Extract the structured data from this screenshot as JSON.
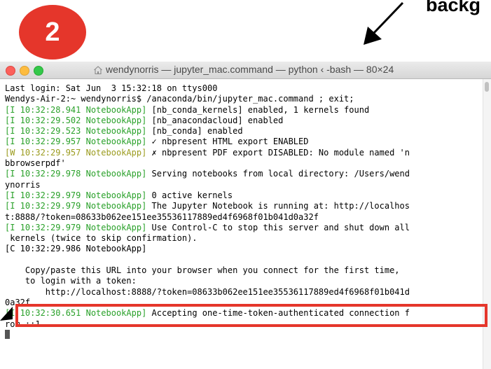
{
  "annotation": {
    "step_number": "2",
    "label_partial": "backg",
    "highlight_color": "#e5362b"
  },
  "window": {
    "title": "wendynorris — jupyter_mac.command — python ‹ -bash — 80×24",
    "title_icon": "home-icon",
    "traffic_lights": [
      "close",
      "minimize",
      "maximize"
    ]
  },
  "terminal": {
    "lines": [
      {
        "prefix": "",
        "body": "Last login: Sat Jun  3 15:32:18 on ttys000"
      },
      {
        "prefix": "",
        "body": "Wendys-Air-2:~ wendynorris$ /anaconda/bin/jupyter_mac.command ; exit;"
      },
      {
        "prefix": "[I 10:32:28.941 NotebookApp]",
        "body": " [nb_conda_kernels] enabled, 1 kernels found"
      },
      {
        "prefix": "[I 10:32:29.502 NotebookApp]",
        "body": " [nb_anacondacloud] enabled"
      },
      {
        "prefix": "[I 10:32:29.523 NotebookApp]",
        "body": " [nb_conda] enabled"
      },
      {
        "prefix": "[I 10:32:29.957 NotebookApp]",
        "body": " ✓ nbpresent HTML export ENABLED"
      },
      {
        "prefix": "[W 10:32:29.957 NotebookApp]",
        "body": " ✗ nbpresent PDF export DISABLED: No module named 'n",
        "warn": true
      },
      {
        "prefix": "",
        "body": "bbrowserpdf'"
      },
      {
        "prefix": "[I 10:32:29.978 NotebookApp]",
        "body": " Serving notebooks from local directory: /Users/wend"
      },
      {
        "prefix": "",
        "body": "ynorris"
      },
      {
        "prefix": "[I 10:32:29.979 NotebookApp]",
        "body": " 0 active kernels"
      },
      {
        "prefix": "[I 10:32:29.979 NotebookApp]",
        "body": " The Jupyter Notebook is running at: http://localhos"
      },
      {
        "prefix": "",
        "body": "t:8888/?token=08633b062ee151ee35536117889ed4f6968f01b041d0a32f"
      },
      {
        "prefix": "[I 10:32:29.979 NotebookApp]",
        "body": " Use Control-C to stop this server and shut down all"
      },
      {
        "prefix": "",
        "body": " kernels (twice to skip confirmation)."
      },
      {
        "prefix": "",
        "body": "[C 10:32:29.986 NotebookApp]"
      },
      {
        "prefix": "",
        "body": ""
      },
      {
        "prefix": "",
        "body": "    Copy/paste this URL into your browser when you connect for the first time,"
      },
      {
        "prefix": "",
        "body": "    to login with a token:"
      },
      {
        "prefix": "",
        "body": "        http://localhost:8888/?token=08633b062ee151ee35536117889ed4f6968f01b041d"
      },
      {
        "prefix": "",
        "body": "0a32f"
      },
      {
        "prefix": "[I 10:32:30.651 NotebookApp]",
        "body": " Accepting one-time-token-authenticated connection f"
      },
      {
        "prefix": "",
        "body": "rom ::1"
      }
    ]
  }
}
